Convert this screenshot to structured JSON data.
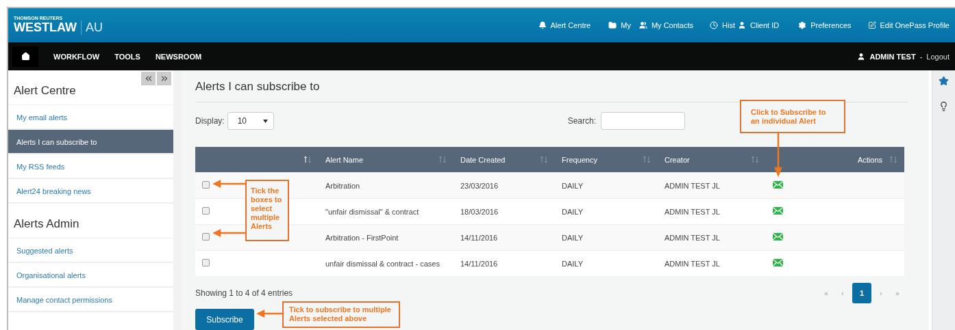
{
  "header": {
    "brand_top": "THOMSON REUTERS",
    "brand": "WESTLAW",
    "region": "AU",
    "links": [
      {
        "kind": "bell",
        "label": "Alert Centre"
      },
      {
        "kind": "folder",
        "label": "My"
      },
      {
        "kind": "contacts",
        "label": "My Contacts"
      },
      {
        "kind": "clock",
        "label": "Hist"
      },
      {
        "kind": "user",
        "label": "Client ID"
      },
      {
        "kind": "gear",
        "label": "Preferences"
      },
      {
        "kind": "edit",
        "label": "Edit OnePass Profile"
      }
    ]
  },
  "nav": {
    "items": [
      "WORKFLOW",
      "TOOLS",
      "NEWSROOM"
    ],
    "user": "ADMIN TEST",
    "separator": "-",
    "logout": "Logout"
  },
  "sidebar": {
    "sections": [
      {
        "title": "Alert Centre",
        "items": [
          {
            "label": "My email alerts",
            "selected": false
          },
          {
            "label": "Alerts I can subscribe to",
            "selected": true
          },
          {
            "label": "My RSS feeds",
            "selected": false
          },
          {
            "label": "Alert24 breaking news",
            "selected": false
          }
        ]
      },
      {
        "title": "Alerts Admin",
        "items": [
          {
            "label": "Suggested alerts",
            "selected": false
          },
          {
            "label": "Organisational alerts",
            "selected": false
          },
          {
            "label": "Manage contact permissions",
            "selected": false
          }
        ]
      }
    ]
  },
  "main": {
    "title": "Alerts I can subscribe to",
    "display": {
      "label": "Display:",
      "value": "10"
    },
    "search": {
      "label": "Search:"
    },
    "table": {
      "columns": [
        {
          "sorted": true
        },
        {
          "label": "Alert Name",
          "sorted": false
        },
        {
          "label": "Date Created",
          "sorted": false
        },
        {
          "label": "Frequency",
          "sorted": false
        },
        {
          "label": "Creator",
          "sorted": false
        },
        {
          "label": "Actions",
          "sorted": false
        }
      ],
      "rows": [
        {
          "checked": false,
          "name": "Arbitration",
          "date": "23/03/2016",
          "frequency": "DAILY",
          "creator": "ADMIN TEST JL"
        },
        {
          "checked": false,
          "name": "\"unfair dismissal\" & contract",
          "date": "18/03/2016",
          "frequency": "DAILY",
          "creator": "ADMIN TEST JL"
        },
        {
          "checked": false,
          "name": "Arbitration - FirstPoint",
          "date": "14/11/2016",
          "frequency": "DAILY",
          "creator": "ADMIN TEST JL"
        },
        {
          "checked": false,
          "name": "unfair dismissal & contract - cases",
          "date": "14/11/2016",
          "frequency": "DAILY",
          "creator": "ADMIN TEST JL"
        }
      ]
    },
    "info": "Showing 1 to 4 of 4 entries",
    "pagination": [
      {
        "label": "«",
        "selected": false
      },
      {
        "label": "‹",
        "selected": false
      },
      {
        "label": "1",
        "selected": true
      },
      {
        "label": "›",
        "selected": false
      },
      {
        "label": "»",
        "selected": false
      }
    ],
    "subscribe": "Subscribe"
  },
  "callouts": [
    {
      "text": "Tick the boxes to select multiple Alerts"
    },
    {
      "text": "Click to Subscribe to an individual Alert"
    },
    {
      "text": "Tick to subscribe to multiple Alerts selected above"
    }
  ]
}
